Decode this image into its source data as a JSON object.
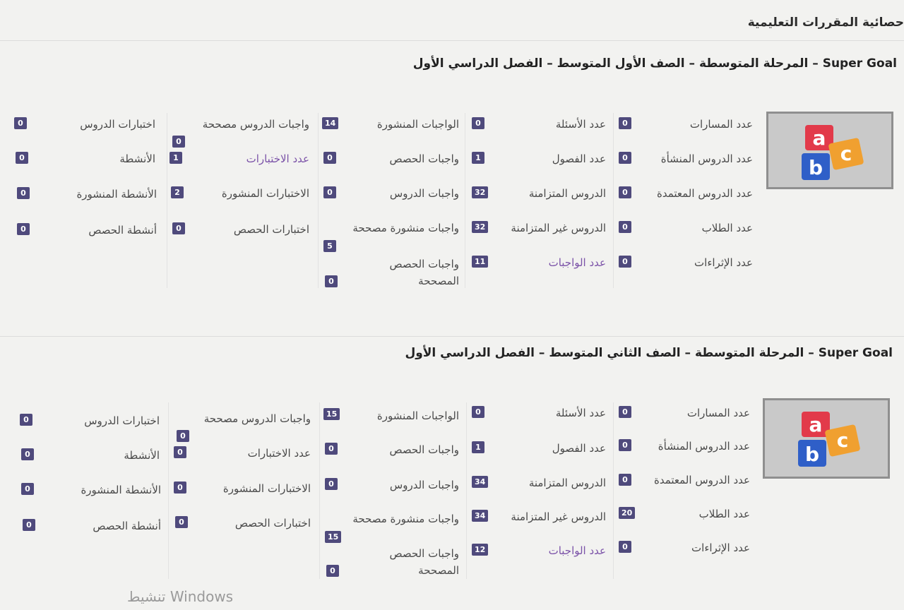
{
  "page_title": "حصائية المقررات التعليمية",
  "watermark": "تنشيط Windows",
  "sections": [
    {
      "title": "المرحلة المتوسطة – الصف الأول المتوسط – الفصل الدراسي الأول – Super Goal",
      "stats": [
        {
          "label": "عدد المسارات",
          "value": "0"
        },
        {
          "label": "عدد الدروس المنشأة",
          "value": "0"
        },
        {
          "label": "عدد الدروس المعتمدة",
          "value": "0"
        },
        {
          "label": "عدد الطلاب",
          "value": "0"
        },
        {
          "label": "عدد الإثراءات",
          "value": "0"
        },
        {
          "label": "عدد الأسئلة",
          "value": "0"
        },
        {
          "label": "عدد الفصول",
          "value": "1"
        },
        {
          "label": "الدروس المتزامنة",
          "value": "32"
        },
        {
          "label": "الدروس غير المتزامنة",
          "value": "32"
        },
        {
          "label": "عدد الواجبات",
          "value": "11"
        },
        {
          "label": "الواجبات المنشورة",
          "value": "14"
        },
        {
          "label": "واجبات الحصص",
          "value": "0"
        },
        {
          "label": "واجبات الدروس",
          "value": "0"
        },
        {
          "label": "واجبات منشورة مصححة",
          "value": "5"
        },
        {
          "label": "واجبات الحصص المصححة",
          "value": "0"
        },
        {
          "label": "واجبات الدروس مصححة",
          "value": "0"
        },
        {
          "label": "عدد الاختبارات",
          "value": "1"
        },
        {
          "label": "الاختبارات المنشورة",
          "value": "2"
        },
        {
          "label": "اختبارات الحصص",
          "value": "0"
        },
        {
          "label": "اختبارات الدروس",
          "value": "0"
        },
        {
          "label": "الأنشطة",
          "value": "0"
        },
        {
          "label": "الأنشطة المنشورة",
          "value": "0"
        },
        {
          "label": "أنشطة الحصص",
          "value": "0"
        }
      ]
    },
    {
      "title": "المرحلة المتوسطة – الصف الثاني المتوسط – الفصل الدراسي الأول – Super Goal",
      "stats": [
        {
          "label": "عدد المسارات",
          "value": "0"
        },
        {
          "label": "عدد الدروس المنشأة",
          "value": "0"
        },
        {
          "label": "عدد الدروس المعتمدة",
          "value": "0"
        },
        {
          "label": "عدد الطلاب",
          "value": "20"
        },
        {
          "label": "عدد الإثراءات",
          "value": "0"
        },
        {
          "label": "عدد الأسئلة",
          "value": "0"
        },
        {
          "label": "عدد الفصول",
          "value": "1"
        },
        {
          "label": "الدروس المتزامنة",
          "value": "34"
        },
        {
          "label": "الدروس غير المتزامنة",
          "value": "34"
        },
        {
          "label": "عدد الواجبات",
          "value": "12"
        },
        {
          "label": "الواجبات المنشورة",
          "value": "15"
        },
        {
          "label": "واجبات الحصص",
          "value": "0"
        },
        {
          "label": "واجبات الدروس",
          "value": "0"
        },
        {
          "label": "واجبات منشورة مصححة",
          "value": "15"
        },
        {
          "label": "واجبات الحصص المصححة",
          "value": "0"
        },
        {
          "label": "واجبات الدروس مصححة",
          "value": "0"
        },
        {
          "label": "عدد الاختبارات",
          "value": "0"
        },
        {
          "label": "الاختبارات المنشورة",
          "value": "0"
        },
        {
          "label": "اختبارات الحصص",
          "value": "0"
        },
        {
          "label": "اختبارات الدروس",
          "value": "0"
        },
        {
          "label": "الأنشطة",
          "value": "0"
        },
        {
          "label": "الأنشطة المنشورة",
          "value": "0"
        },
        {
          "label": "أنشطة الحصص",
          "value": "0"
        }
      ]
    }
  ]
}
